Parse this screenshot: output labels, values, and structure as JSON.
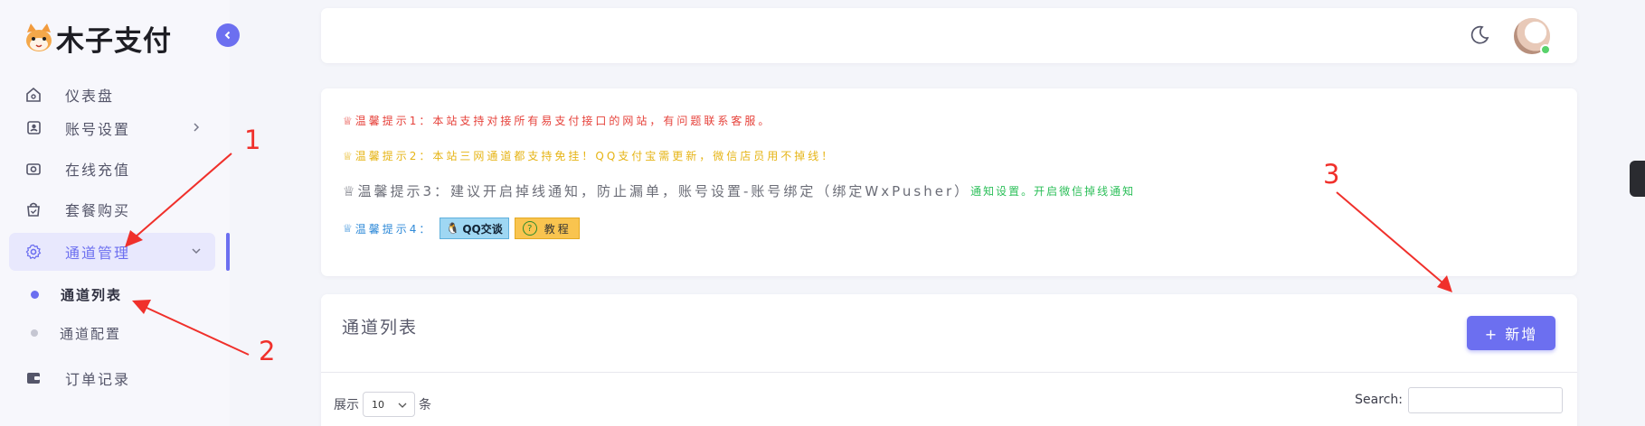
{
  "brand": {
    "name": "木子支付"
  },
  "sidebar": {
    "items": [
      {
        "label": "仪表盘",
        "icon": "home-icon"
      },
      {
        "label": "账号设置",
        "icon": "account-icon"
      },
      {
        "label": "在线充值",
        "icon": "camera-icon"
      },
      {
        "label": "套餐购买",
        "icon": "shopping-bag-icon"
      },
      {
        "label": "通道管理",
        "icon": "gear-icon"
      },
      {
        "label": "订单记录",
        "icon": "wallet-icon"
      }
    ],
    "sub_items": [
      {
        "label": "通道列表"
      },
      {
        "label": "通道配置"
      }
    ]
  },
  "notices": {
    "n1": "温馨提示1：本站支持对接所有易支付接口的网站，有问题联系客服。",
    "n2": "温馨提示2：本站三网通道都支持免挂！QQ支付宝需更新，微信店员用不掉线！",
    "n3": "温馨提示3：建议开启掉线通知，防止漏单，账号设置-账号绑定（绑定WxPusher）",
    "n3_link": "通知设置。开启微信掉线通知",
    "n4": "温馨提示4：",
    "qq_badge": "QQ交谈",
    "tutorial_badge": "教程"
  },
  "list": {
    "title": "通道列表",
    "add_button": "+ 新增",
    "show_prefix": "展示",
    "page_size": "10",
    "show_suffix": "条",
    "search_label": "Search:"
  },
  "annotations": {
    "a1": "1",
    "a2": "2",
    "a3": "3"
  },
  "colors": {
    "accent": "#6c6ff0",
    "red": "#e6413a",
    "yellow": "#e6b416",
    "green": "#2cbf59",
    "blue": "#2f8ad8",
    "annotation": "#f0302b"
  }
}
